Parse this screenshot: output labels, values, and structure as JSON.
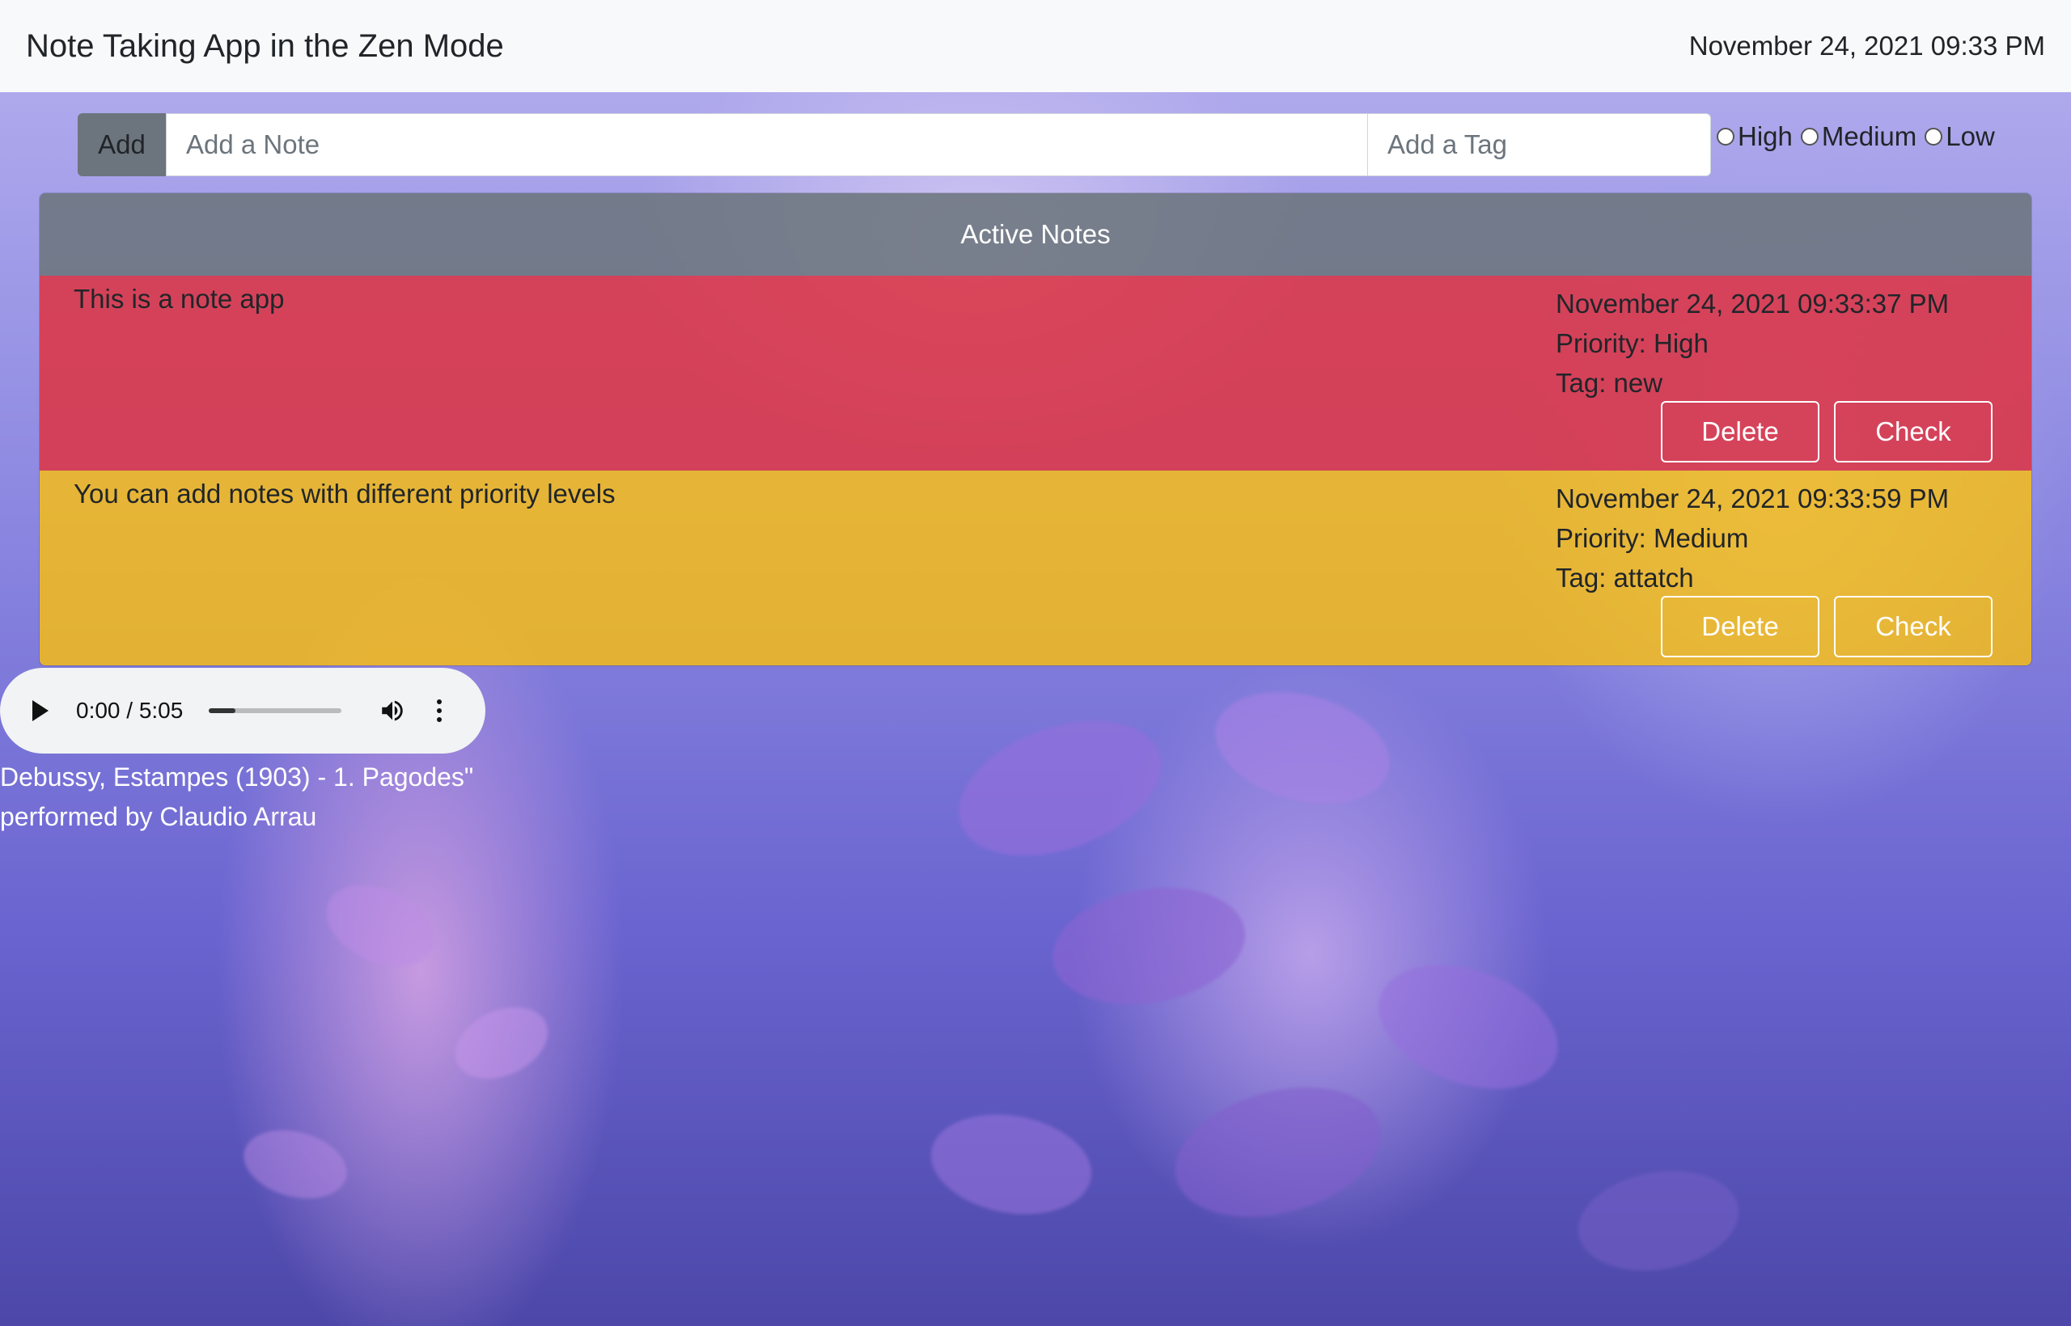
{
  "app": {
    "title": "Note Taking App in the Zen Mode",
    "datetime": "November 24, 2021 09:33 PM"
  },
  "add_form": {
    "add_label": "Add",
    "note_placeholder": "Add a Note",
    "tag_placeholder": "Add a Tag",
    "priority_options": [
      "High",
      "Medium",
      "Low"
    ]
  },
  "notes_card": {
    "header": "Active Notes",
    "notes": [
      {
        "text": "This is a note app",
        "timestamp": "November 24, 2021 09:33:37 PM",
        "priority": "Priority: High",
        "tag": "Tag: new",
        "delete_label": "Delete",
        "check_label": "Check",
        "color": "#dc3545"
      },
      {
        "text": "You can add notes with different priority levels",
        "timestamp": "November 24, 2021 09:33:59 PM",
        "priority": "Priority: Medium",
        "tag": "Tag: attatch",
        "delete_label": "Delete",
        "check_label": "Check",
        "color": "#ffc107"
      }
    ]
  },
  "audio": {
    "time": "0:00 / 5:05",
    "progress": 0.2,
    "caption_line1": "Debussy, Estampes (1903) - 1. Pagodes\"",
    "caption_line2": "performed by Claudio Arrau"
  }
}
